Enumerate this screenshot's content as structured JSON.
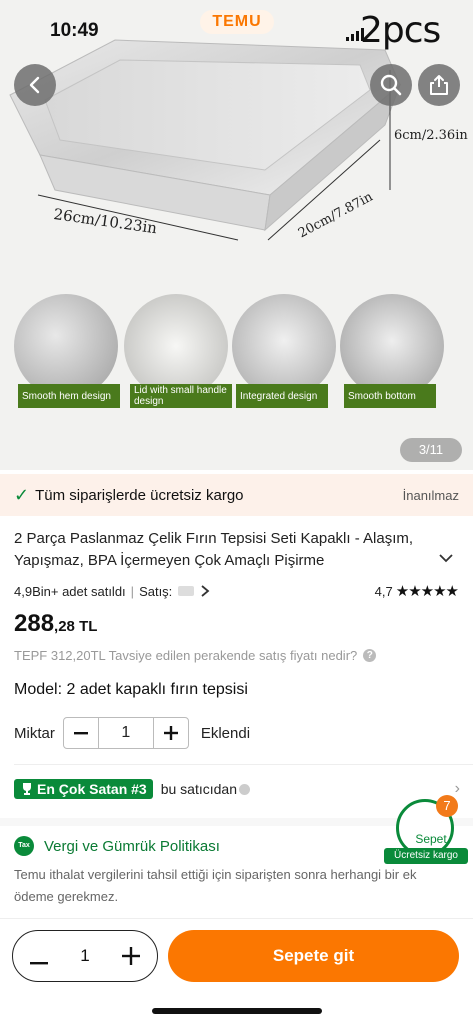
{
  "status_bar": {
    "time": "10:49"
  },
  "header": {
    "brand": "TEMU",
    "overlay_text": "2pcs"
  },
  "icons": {
    "back": "chevron-left-icon",
    "search": "search-icon",
    "share": "share-icon"
  },
  "product_image": {
    "width_label": "26cm/10.23in",
    "depth_label": "20cm/7.87in",
    "height_label": "6cm/2.36in",
    "feature_thumbs": [
      {
        "label": "Smooth hem design"
      },
      {
        "label": "Lid with small handle design"
      },
      {
        "label": "Integrated design"
      },
      {
        "label": "Smooth bottom"
      }
    ],
    "page_indicator": "3/11"
  },
  "shipping_banner": {
    "text": "Tüm siparişlerde ücretsiz kargo",
    "link": "İnanılmaz"
  },
  "product": {
    "title": "2 Parça Paslanmaz Çelik Fırın Tepsisi Seti Kapaklı - Alaşım, Yapışmaz, BPA İçermeyen Çok Amaçlı Pişirme",
    "sold": "4,9Bin+ adet satıldı",
    "sold_separator": "|",
    "seller_label": "Satış:",
    "rating_value": "4,7",
    "rating_stars": 5,
    "price_int": "288",
    "price_dec": ",28 TL",
    "rrp_text": "TEPF 312,20TL Tavsiye edilen perakende satış fiyatı nedir?",
    "model_text": "Model: 2 adet kapaklı fırın tepsisi"
  },
  "quantity": {
    "label": "Miktar",
    "value": "1",
    "added_text": "Eklendi"
  },
  "bestseller": {
    "badge": "En Çok Satan #3",
    "text": "bu satıcıdan"
  },
  "cart_widget": {
    "count": "7",
    "label": "Sepet",
    "sub": "Ücretsiz kargo"
  },
  "tax": {
    "icon_text": "Tax",
    "title": "Vergi ve Gümrük Politikası",
    "body": "Temu ithalat vergilerini tahsil ettiği için siparişten sonra herhangi bir ek ödeme gerekmez."
  },
  "bottom_bar": {
    "qty": "1",
    "go_cart": "Sepete git"
  },
  "colors": {
    "accent": "#fb7701",
    "green": "#0a8a3a",
    "feature_label": "#4a7a1c"
  }
}
